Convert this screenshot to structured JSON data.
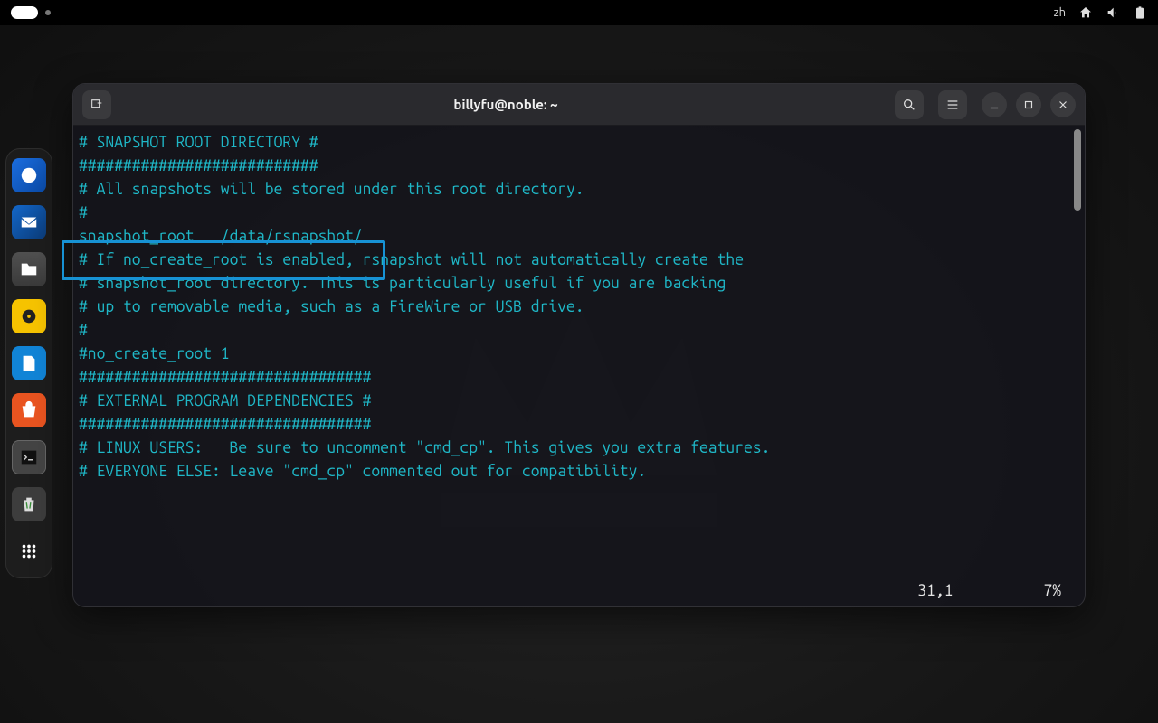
{
  "top_panel": {
    "lang": "zh"
  },
  "dock": {
    "items": [
      {
        "name": "edge",
        "title": "Microsoft Edge"
      },
      {
        "name": "tbird",
        "title": "Thunderbird"
      },
      {
        "name": "files",
        "title": "Files"
      },
      {
        "name": "music",
        "title": "Rhythmbox"
      },
      {
        "name": "writer",
        "title": "LibreOffice Writer"
      },
      {
        "name": "store",
        "title": "Software"
      },
      {
        "name": "term",
        "title": "Terminal"
      },
      {
        "name": "trash",
        "title": "Trash"
      },
      {
        "name": "apps",
        "title": "Show Applications"
      }
    ]
  },
  "terminal": {
    "title": "billyfu@noble: ~",
    "content_lines": [
      "# SNAPSHOT ROOT DIRECTORY #",
      "###########################",
      "",
      "# All snapshots will be stored under this root directory.",
      "#",
      "snapshot_root   /data/rsnapshot/",
      "",
      "# If no_create_root is enabled, rsnapshot will not automatically create the",
      "# snapshot_root directory. This is particularly useful if you are backing",
      "# up to removable media, such as a FireWire or USB drive.",
      "#",
      "#no_create_root 1",
      "",
      "#################################",
      "# EXTERNAL PROGRAM DEPENDENCIES #",
      "#################################",
      "",
      "# LINUX USERS:   Be sure to uncomment \"cmd_cp\". This gives you extra features.",
      "# EVERYONE ELSE: Leave \"cmd_cp\" commented out for compatibility."
    ],
    "status": {
      "position": "31,1",
      "percent": "7%"
    }
  }
}
